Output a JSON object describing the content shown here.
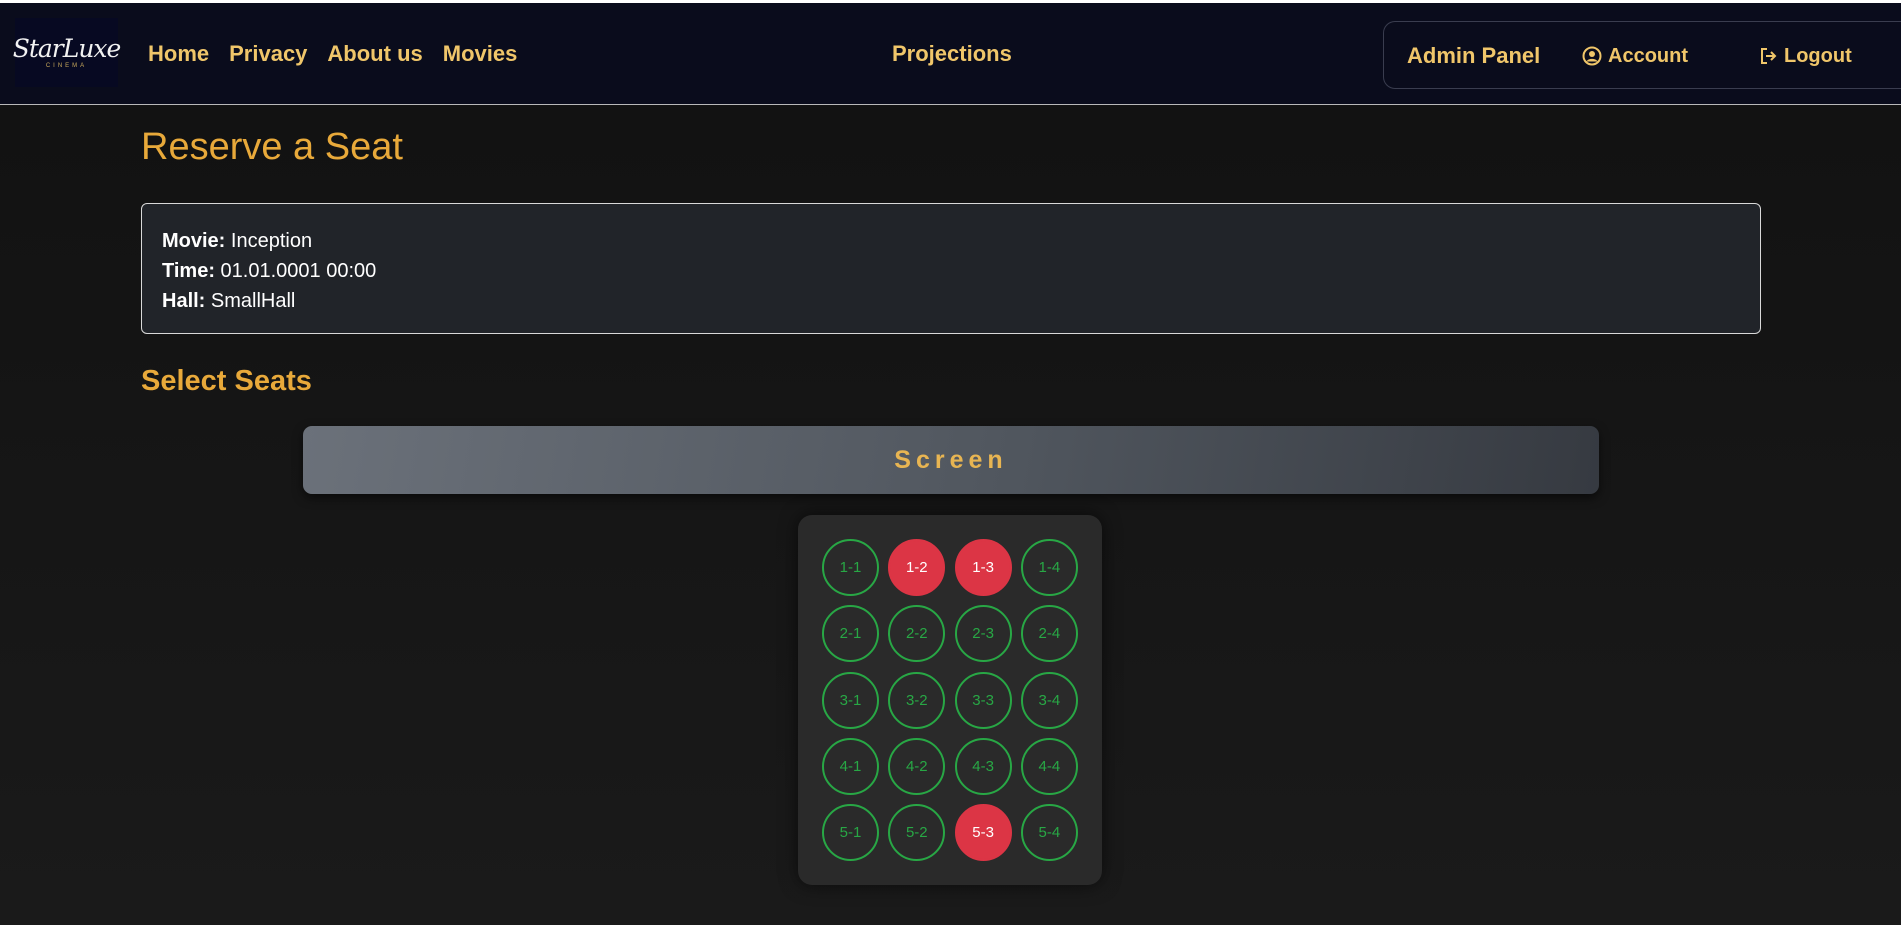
{
  "brand": {
    "logo_text": "StarLuxe",
    "logo_sub": "CINEMA"
  },
  "nav": {
    "home": "Home",
    "privacy": "Privacy",
    "about": "About us",
    "movies": "Movies",
    "projections": "Projections",
    "admin": "Admin Panel",
    "account": "Account",
    "account_icon": "user-circle-icon",
    "logout": "Logout",
    "logout_icon": "logout-icon"
  },
  "page": {
    "title": "Reserve a Seat",
    "section_title": "Select Seats",
    "screen_label": "Screen"
  },
  "info": {
    "movie_label": "Movie:",
    "movie_value": "Inception",
    "time_label": "Time:",
    "time_value": "01.01.0001 00:00",
    "hall_label": "Hall:",
    "hall_value": "SmallHall"
  },
  "colors": {
    "accent": "#e8a93a",
    "nav_text": "#f0c66a",
    "seat_available": "#28a745",
    "seat_taken": "#dc3545",
    "navbar_bg": "#0a0c1c"
  },
  "seats": [
    {
      "label": "1-1",
      "taken": false
    },
    {
      "label": "1-2",
      "taken": true
    },
    {
      "label": "1-3",
      "taken": true
    },
    {
      "label": "1-4",
      "taken": false
    },
    {
      "label": "2-1",
      "taken": false
    },
    {
      "label": "2-2",
      "taken": false
    },
    {
      "label": "2-3",
      "taken": false
    },
    {
      "label": "2-4",
      "taken": false
    },
    {
      "label": "3-1",
      "taken": false
    },
    {
      "label": "3-2",
      "taken": false
    },
    {
      "label": "3-3",
      "taken": false
    },
    {
      "label": "3-4",
      "taken": false
    },
    {
      "label": "4-1",
      "taken": false
    },
    {
      "label": "4-2",
      "taken": false
    },
    {
      "label": "4-3",
      "taken": false
    },
    {
      "label": "4-4",
      "taken": false
    },
    {
      "label": "5-1",
      "taken": false
    },
    {
      "label": "5-2",
      "taken": false
    },
    {
      "label": "5-3",
      "taken": true
    },
    {
      "label": "5-4",
      "taken": false
    }
  ]
}
